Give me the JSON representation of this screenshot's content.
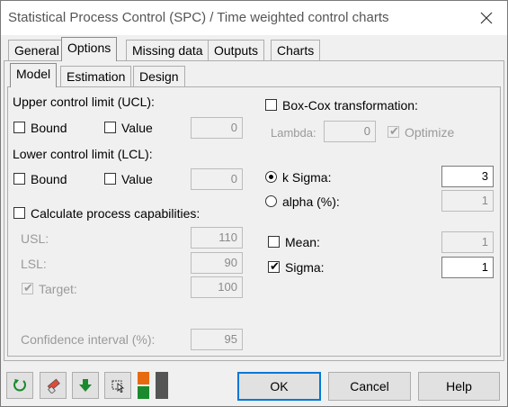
{
  "window": {
    "title": "Statistical Process Control (SPC) / Time weighted control charts"
  },
  "tabs": [
    "General",
    "Options",
    "Missing data",
    "Outputs",
    "Charts"
  ],
  "subtabs": [
    "Model",
    "Estimation",
    "Design"
  ],
  "ucl": {
    "heading": "Upper control limit (UCL):",
    "bound_label": "Bound",
    "value_label": "Value",
    "value": "0"
  },
  "lcl": {
    "heading": "Lower control limit (LCL):",
    "bound_label": "Bound",
    "value_label": "Value",
    "value": "0"
  },
  "capabilities": {
    "label": "Calculate process capabilities:",
    "usl_label": "USL:",
    "usl": "110",
    "lsl_label": "LSL:",
    "lsl": "90",
    "target_label": "Target:",
    "target": "100",
    "ci_label": "Confidence interval (%):",
    "ci": "95"
  },
  "boxcox": {
    "label": "Box-Cox transformation:",
    "lambda_label": "Lambda:",
    "lambda": "0",
    "optimize_label": "Optimize"
  },
  "limits": {
    "ksigma_label": "k Sigma:",
    "ksigma": "3",
    "alpha_label": "alpha (%):",
    "alpha": "1"
  },
  "params": {
    "mean_label": "Mean:",
    "mean": "1",
    "sigma_label": "Sigma:",
    "sigma": "1"
  },
  "buttons": {
    "ok": "OK",
    "cancel": "Cancel",
    "help": "Help"
  },
  "icons": [
    "reset-icon",
    "eraser-icon",
    "download-arrow-icon",
    "select-icon",
    "layout-toggle-icon"
  ],
  "colors": {
    "accent": "#0078d7",
    "green": "#1b8a2e",
    "orange": "#e86a10"
  }
}
